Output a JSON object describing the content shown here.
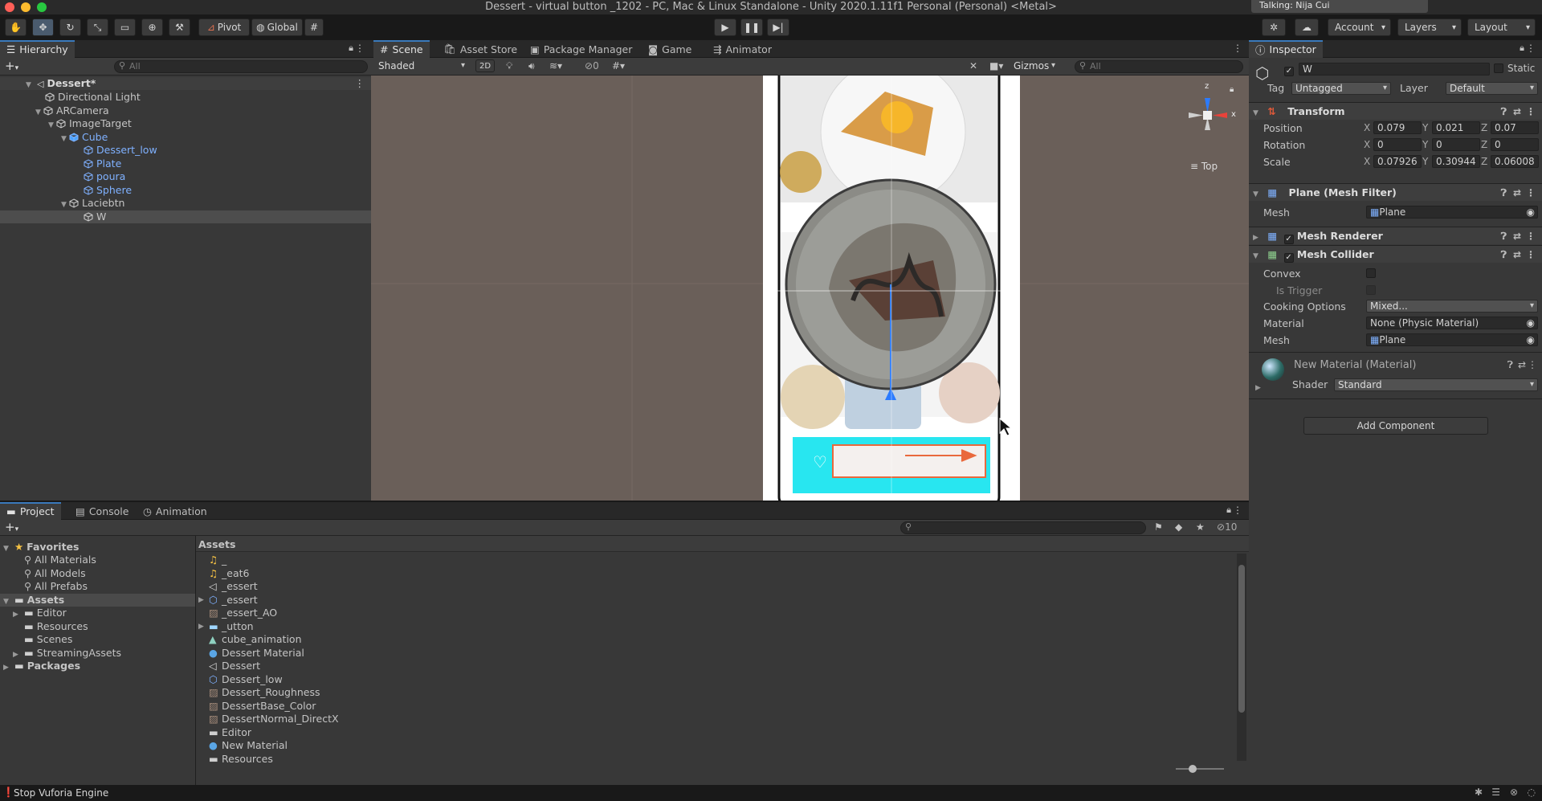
{
  "window": {
    "title": "Dessert - virtual button _1202 - PC, Mac & Linux Standalone - Unity 2020.1.11f1 Personal (Personal) <Metal>",
    "notification": "Talking: Nija Cui"
  },
  "toolbar": {
    "pivot": "Pivot",
    "global": "Global",
    "account": "Account",
    "layers": "Layers",
    "layout": "Layout"
  },
  "hierarchy": {
    "tab": "Hierarchy",
    "search_placeholder": "All",
    "scene": "Dessert*",
    "items": [
      {
        "label": "Directional Light",
        "blue": false
      },
      {
        "label": "ARCamera",
        "blue": false
      },
      {
        "label": "ImageTarget",
        "blue": false
      },
      {
        "label": "Cube",
        "blue": true
      },
      {
        "label": "Dessert_low",
        "blue": true
      },
      {
        "label": "Plate",
        "blue": true
      },
      {
        "label": "poura",
        "blue": true
      },
      {
        "label": "Sphere",
        "blue": true
      },
      {
        "label": "Laciebtn",
        "blue": false
      },
      {
        "label": "W",
        "blue": false
      }
    ]
  },
  "scene_tabs": [
    "Scene",
    "Asset Store",
    "Package Manager",
    "Game",
    "Animator"
  ],
  "scene_toolbar": {
    "shading": "Shaded",
    "mode_2d": "2D",
    "hidden_count": "0",
    "gizmos": "Gizmos",
    "search_placeholder": "All"
  },
  "gizmo": {
    "x": "x",
    "z": "z",
    "view": "Top"
  },
  "inspector": {
    "tab": "Inspector",
    "object_name": "W",
    "static_label": "Static",
    "tag_label": "Tag",
    "tag_value": "Untagged",
    "layer_label": "Layer",
    "layer_value": "Default",
    "transform": {
      "title": "Transform",
      "position_label": "Position",
      "position": {
        "x": "0.079",
        "y": "0.021",
        "z": "0.07"
      },
      "rotation_label": "Rotation",
      "rotation": {
        "x": "0",
        "y": "0",
        "z": "0"
      },
      "scale_label": "Scale",
      "scale": {
        "x": "0.07926",
        "y": "0.30944",
        "z": "0.06008"
      }
    },
    "mesh_filter": {
      "title": "Plane (Mesh Filter)",
      "mesh_label": "Mesh",
      "mesh_value": "Plane"
    },
    "mesh_renderer": {
      "title": "Mesh Renderer"
    },
    "mesh_collider": {
      "title": "Mesh Collider",
      "convex_label": "Convex",
      "is_trigger_label": "Is Trigger",
      "cooking_label": "Cooking Options",
      "cooking_value": "Mixed...",
      "material_label": "Material",
      "material_value": "None (Physic Material)",
      "mesh_label": "Mesh",
      "mesh_value": "Plane"
    },
    "material": {
      "title": "New Material (Material)",
      "shader_label": "Shader",
      "shader_value": "Standard"
    },
    "add_component": "Add Component"
  },
  "project": {
    "tabs": [
      "Project",
      "Console",
      "Animation"
    ],
    "favorites": "Favorites",
    "favorite_items": [
      "All Materials",
      "All Models",
      "All Prefabs"
    ],
    "assets_root": "Assets",
    "asset_folders": [
      "Editor",
      "Resources",
      "Scenes",
      "StreamingAssets"
    ],
    "packages": "Packages",
    "breadcrumb": "Assets",
    "hidden_count": "10",
    "files": [
      {
        "name": "_",
        "icon": "audio-icon"
      },
      {
        "name": "_eat6",
        "icon": "audio-icon"
      },
      {
        "name": "_essert",
        "icon": "scene-icon"
      },
      {
        "name": "_essert",
        "icon": "prefab-icon"
      },
      {
        "name": "_essert_AO",
        "icon": "texture-icon"
      },
      {
        "name": "_utton",
        "icon": "model-icon"
      },
      {
        "name": "cube_animation",
        "icon": "animation-icon"
      },
      {
        "name": "Dessert Material",
        "icon": "material-icon"
      },
      {
        "name": "Dessert",
        "icon": "scene-icon"
      },
      {
        "name": "Dessert_low",
        "icon": "prefab-icon"
      },
      {
        "name": "Dessert_Roughness",
        "icon": "texture-icon"
      },
      {
        "name": "DessertBase_Color",
        "icon": "texture-icon"
      },
      {
        "name": "DessertNormal_DirectX",
        "icon": "texture-icon"
      },
      {
        "name": "Editor",
        "icon": "folder-icon"
      },
      {
        "name": "New Material",
        "icon": "material-icon"
      },
      {
        "name": "Resources",
        "icon": "folder-icon"
      }
    ]
  },
  "status": {
    "message": "Stop Vuforia Engine"
  },
  "colors": {
    "accent": "#3a79bb",
    "link_blue": "#7fb1ff",
    "scene_bg": "#6a5f59"
  }
}
